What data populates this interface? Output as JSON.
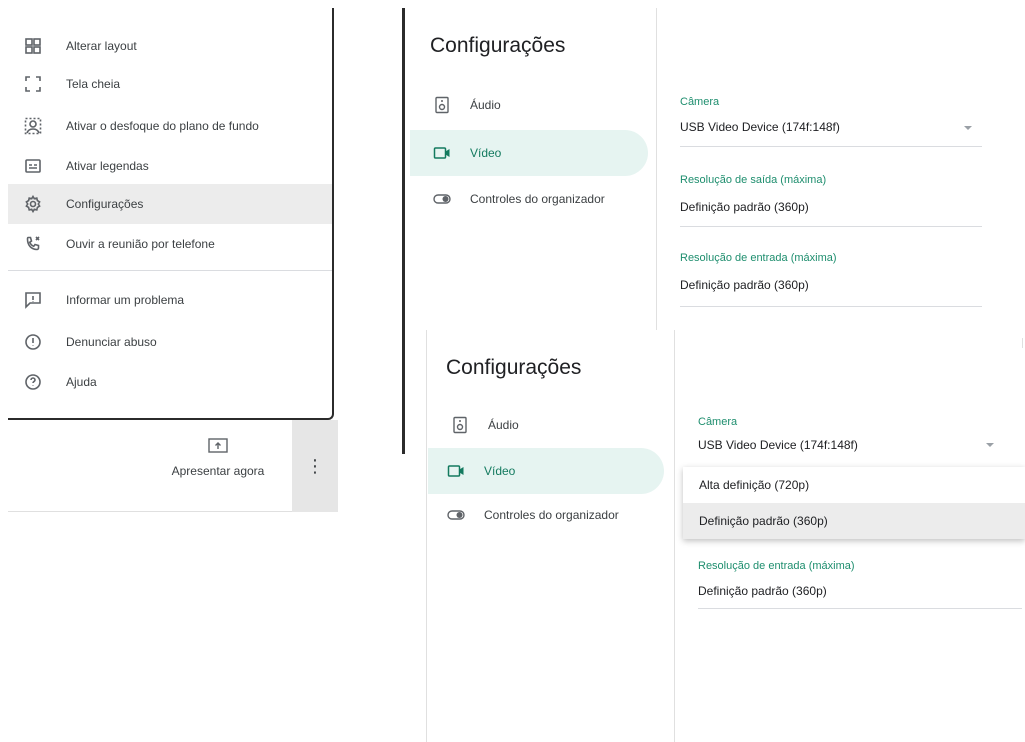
{
  "menu": {
    "items": [
      {
        "label": "Alterar layout",
        "icon": "layout-icon"
      },
      {
        "label": "Tela cheia",
        "icon": "fullscreen-icon"
      },
      {
        "label": "Ativar o desfoque do plano de fundo",
        "icon": "blur-background-icon"
      },
      {
        "label": "Ativar legendas",
        "icon": "captions-icon"
      },
      {
        "label": "Configurações",
        "icon": "gear-icon"
      },
      {
        "label": "Ouvir a reunião por telefone",
        "icon": "phone-icon"
      },
      {
        "label": "Informar um problema",
        "icon": "report-problem-icon"
      },
      {
        "label": "Denunciar abuso",
        "icon": "info-icon"
      },
      {
        "label": "Ajuda",
        "icon": "help-icon"
      }
    ]
  },
  "bottom_bar": {
    "present_label": "Apresentar agora",
    "more_label": "⋮"
  },
  "settings": {
    "title": "Configurações",
    "nav": [
      {
        "label": "Áudio",
        "icon": "speaker-icon"
      },
      {
        "label": "Vídeo",
        "icon": "video-icon"
      },
      {
        "label": "Controles do organizador",
        "icon": "toggle-icon"
      }
    ],
    "camera_label": "Câmera",
    "camera_value": "USB Video Device (174f:148f)",
    "send_res_label": "Resolução de saída (máxima)",
    "send_res_value": "Definição padrão (360p)",
    "recv_res_label": "Resolução de entrada (máxima)",
    "recv_res_value": "Definição padrão (360p)"
  },
  "dropdown": {
    "options": [
      "Alta definição (720p)",
      "Definição padrão (360p)"
    ],
    "selected": "Definição padrão (360p)"
  },
  "colors": {
    "accent": "#1e8e6e",
    "nav_active_bg": "#e6f4f1"
  }
}
